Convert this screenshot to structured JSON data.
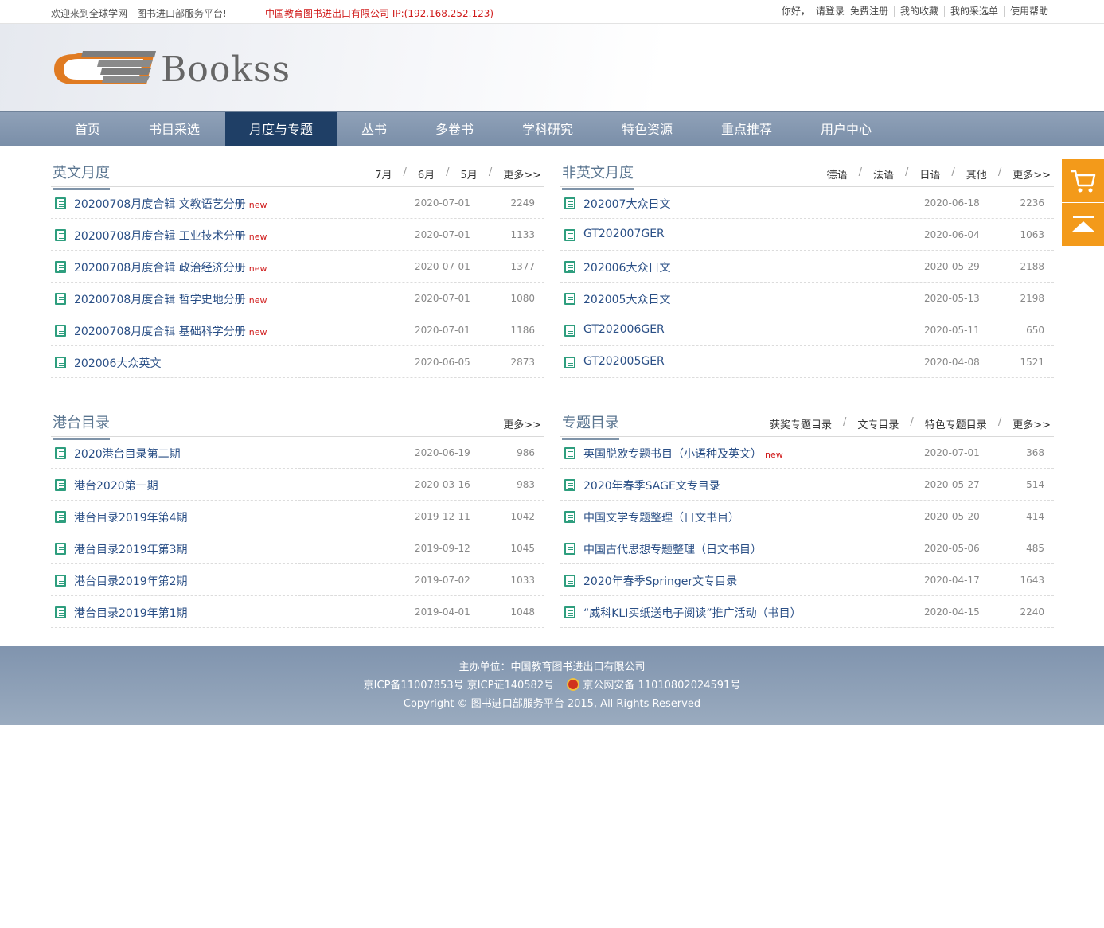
{
  "topbar": {
    "welcome": "欢迎来到全球学网 - 图书进口部服务平台!",
    "org": "中国教育图书进出口有限公司 IP:(192.168.252.123)",
    "hello": "你好，",
    "login": "请登录",
    "register": "免费注册",
    "favorites": "我的收藏",
    "orders": "我的采选单",
    "help": "使用帮助"
  },
  "logo": {
    "text": "Bookss"
  },
  "nav": {
    "items": [
      "首页",
      "书目采选",
      "月度与专题",
      "丛书",
      "多卷书",
      "学科研究",
      "特色资源",
      "重点推荐",
      "用户中心"
    ],
    "active": "月度与专题"
  },
  "colors": {
    "nav_active": "#1f3f66",
    "accent": "#f39a1a",
    "link": "#2a4f86",
    "new": "#d01b1b",
    "icon": "#2e9e7e"
  },
  "panels": {
    "en": {
      "title": "英文月度",
      "tabs": [
        "7月",
        "6月",
        "5月",
        "更多>>"
      ],
      "rows": [
        {
          "title": "20200708月度合辑 文教语艺分册",
          "new": "new",
          "date": "2020-07-01",
          "count": "2249"
        },
        {
          "title": "20200708月度合辑 工业技术分册",
          "new": "new",
          "date": "2020-07-01",
          "count": "1133"
        },
        {
          "title": "20200708月度合辑 政治经济分册",
          "new": "new",
          "date": "2020-07-01",
          "count": "1377"
        },
        {
          "title": "20200708月度合辑 哲学史地分册",
          "new": "new",
          "date": "2020-07-01",
          "count": "1080"
        },
        {
          "title": "20200708月度合辑 基础科学分册",
          "new": "new",
          "date": "2020-07-01",
          "count": "1186"
        },
        {
          "title": "202006大众英文",
          "new": "",
          "date": "2020-06-05",
          "count": "2873"
        }
      ]
    },
    "nonen": {
      "title": "非英文月度",
      "tabs": [
        "德语",
        "法语",
        "日语",
        "其他",
        "更多>>"
      ],
      "rows": [
        {
          "title": "202007大众日文",
          "new": "",
          "date": "2020-06-18",
          "count": "2236"
        },
        {
          "title": "GT202007GER",
          "new": "",
          "date": "2020-06-04",
          "count": "1063"
        },
        {
          "title": "202006大众日文",
          "new": "",
          "date": "2020-05-29",
          "count": "2188"
        },
        {
          "title": "202005大众日文",
          "new": "",
          "date": "2020-05-13",
          "count": "2198"
        },
        {
          "title": "GT202006GER",
          "new": "",
          "date": "2020-05-11",
          "count": "650"
        },
        {
          "title": "GT202005GER",
          "new": "",
          "date": "2020-04-08",
          "count": "1521"
        }
      ]
    },
    "hk": {
      "title": "港台目录",
      "tabs": [
        "更多>>"
      ],
      "rows": [
        {
          "title": "2020港台目录第二期",
          "new": "",
          "date": "2020-06-19",
          "count": "986"
        },
        {
          "title": "港台2020第一期",
          "new": "",
          "date": "2020-03-16",
          "count": "983"
        },
        {
          "title": "港台目录2019年第4期",
          "new": "",
          "date": "2019-12-11",
          "count": "1042"
        },
        {
          "title": "港台目录2019年第3期",
          "new": "",
          "date": "2019-09-12",
          "count": "1045"
        },
        {
          "title": "港台目录2019年第2期",
          "new": "",
          "date": "2019-07-02",
          "count": "1033"
        },
        {
          "title": "港台目录2019年第1期",
          "new": "",
          "date": "2019-04-01",
          "count": "1048"
        }
      ]
    },
    "topic": {
      "title": "专题目录",
      "tabs": [
        "获奖专题目录",
        "文专目录",
        "特色专题目录",
        "更多>>"
      ],
      "rows": [
        {
          "title": "英国脱欧专题书目（小语种及英文）",
          "new": "new",
          "date": "2020-07-01",
          "count": "368"
        },
        {
          "title": "2020年春季SAGE文专目录",
          "new": "",
          "date": "2020-05-27",
          "count": "514"
        },
        {
          "title": "中国文学专题整理（日文书目）",
          "new": "",
          "date": "2020-05-20",
          "count": "414"
        },
        {
          "title": "中国古代思想专题整理（日文书目）",
          "new": "",
          "date": "2020-05-06",
          "count": "485"
        },
        {
          "title": "2020年春季Springer文专目录",
          "new": "",
          "date": "2020-04-17",
          "count": "1643"
        },
        {
          "title": "“威科KLI买纸送电子阅读”推广活动（书目）",
          "new": "",
          "date": "2020-04-15",
          "count": "2240"
        }
      ]
    }
  },
  "footer": {
    "host": "主办单位：中国教育图书进出口有限公司",
    "icp": "京ICP备11007853号  京ICP证140582号",
    "police": "京公网安备 11010802024591号",
    "copyright": "Copyright © 图书进口部服务平台 2015, All Rights Reserved"
  },
  "side": {
    "cart_icon": "cart-icon",
    "top_icon": "back-to-top-icon"
  }
}
